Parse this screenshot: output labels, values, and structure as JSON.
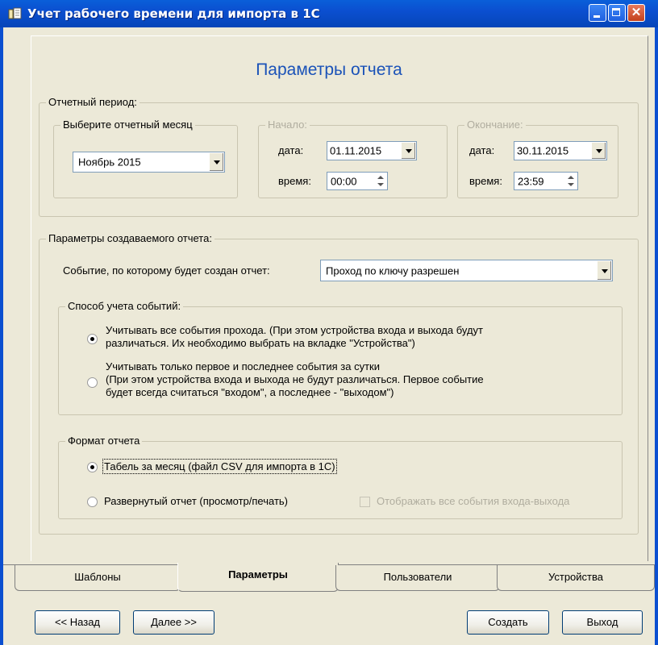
{
  "window": {
    "title": "Учет рабочего времени для импорта в 1С"
  },
  "page_title": "Параметры отчета",
  "period": {
    "legend": "Отчетный период:",
    "month_group": {
      "legend": "Выберите отчетный месяц",
      "selected": "Ноябрь  2015"
    },
    "start": {
      "legend": "Начало:",
      "date_label": "дата:",
      "date_value": "01.11.2015",
      "time_label": "время:",
      "time_value": "00:00"
    },
    "end": {
      "legend": "Окончание:",
      "date_label": "дата:",
      "date_value": "30.11.2015",
      "time_label": "время:",
      "time_value": "23:59"
    }
  },
  "report_params": {
    "legend": "Параметры создаваемого отчета:",
    "event_label": "Событие, по которому будет создан отчет:",
    "event_selected": "Проход по ключу разрешен",
    "accounting": {
      "legend": "Способ учета событий:",
      "option_all_line1": "Учитывать все события прохода. (При этом устройства входа и выхода будут",
      "option_all_line2": "различаться. Их необходимо выбрать на вкладке \"Устройства\")",
      "option_first_last_line1": "Учитывать только первое и последнее события за сутки",
      "option_first_last_line2": "(При этом устройства входа и выхода не будут различаться. Первое событие",
      "option_first_last_line3": "будет всегда считаться \"входом\", а последнее - \"выходом\")",
      "selected": "all"
    },
    "format": {
      "legend": "Формат отчета",
      "option_timesheet": "Табель за месяц (файл CSV для импорта в 1С)",
      "option_detailed": "Развернутый отчет (просмотр/печать)",
      "show_all_events": "Отображать все события входа-выхода",
      "selected": "timesheet"
    }
  },
  "tabs": [
    "Шаблоны",
    "Параметры",
    "Пользователи",
    "Устройства"
  ],
  "active_tab": "Параметры",
  "buttons": {
    "back": "<< Назад",
    "next": "Далее >>",
    "create": "Создать",
    "exit": "Выход"
  }
}
